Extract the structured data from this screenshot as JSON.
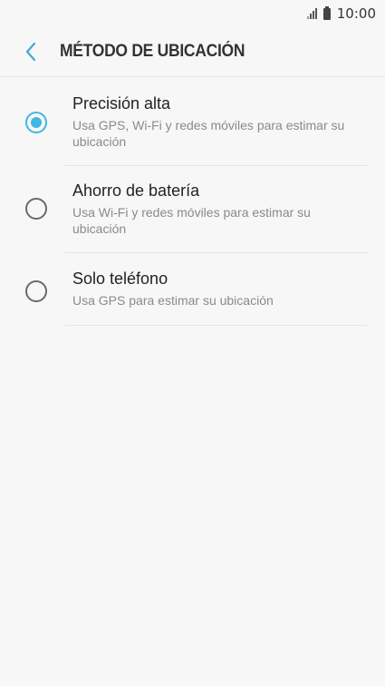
{
  "status_bar": {
    "time": "10:00",
    "icons": [
      "signal-icon",
      "battery-icon"
    ]
  },
  "header": {
    "title": "MÉTODO DE UBICACIÓN",
    "back_icon": "back-chevron-icon"
  },
  "options": [
    {
      "title": "Precisión alta",
      "description": "Usa GPS, Wi-Fi y redes móviles para estimar su ubicación",
      "selected": true
    },
    {
      "title": "Ahorro de batería",
      "description": "Usa Wi-Fi y redes móviles para estimar su ubicación",
      "selected": false
    },
    {
      "title": "Solo teléfono",
      "description": "Usa GPS para estimar su ubicación",
      "selected": false
    }
  ],
  "colors": {
    "accent": "#3fb8e2",
    "background": "#f7f7f7",
    "title_text": "#222222",
    "secondary_text": "#8a8a8a"
  }
}
